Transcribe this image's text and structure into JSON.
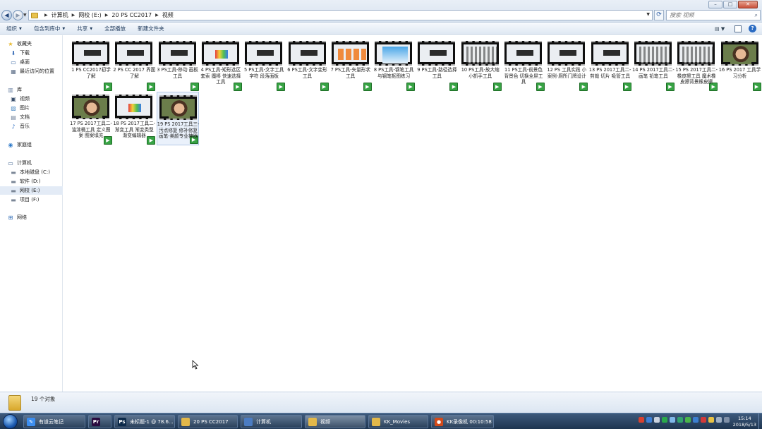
{
  "window": {
    "minimize": "–",
    "maximize": "□",
    "close": "✕"
  },
  "address": {
    "crumbs": [
      "计算机",
      "网校 (E:)",
      "20 PS CC2017",
      "视频"
    ],
    "search_placeholder": "搜索 视频"
  },
  "toolbar": {
    "organize": "组织",
    "include_in_library": "包含到库中",
    "share": "共享",
    "play_all": "全部播放",
    "new_folder": "新建文件夹"
  },
  "sidebar": {
    "items": [
      {
        "label": "收藏夹",
        "icon": "star-icon"
      },
      {
        "label": "下载",
        "icon": "download-icon"
      },
      {
        "label": "桌面",
        "icon": "desktop-icon"
      },
      {
        "label": "最近访问的位置",
        "icon": "recent-places-icon"
      },
      {
        "label": "库",
        "icon": "library-icon"
      },
      {
        "label": "视频",
        "icon": "video-library-icon"
      },
      {
        "label": "图片",
        "icon": "pictures-icon"
      },
      {
        "label": "文档",
        "icon": "documents-icon"
      },
      {
        "label": "音乐",
        "icon": "music-icon"
      },
      {
        "label": "家庭组",
        "icon": "homegroup-icon"
      },
      {
        "label": "计算机",
        "icon": "computer-icon"
      },
      {
        "label": "本地磁盘 (C:)",
        "icon": "drive-icon"
      },
      {
        "label": "软件 (D:)",
        "icon": "drive-icon"
      },
      {
        "label": "网校 (E:)",
        "icon": "drive-icon"
      },
      {
        "label": "项目 (F:)",
        "icon": "drive-icon"
      },
      {
        "label": "网络",
        "icon": "network-icon"
      }
    ]
  },
  "files": [
    {
      "name": "1 PS CC2017初学了解",
      "thumb": "white"
    },
    {
      "name": "2 PS CC 2017 界面了解",
      "thumb": "white"
    },
    {
      "name": "3 PS工具-移动 画板工具",
      "thumb": "white"
    },
    {
      "name": "4 PS工具-矩形选区 套索 魔棒 快速选择工具",
      "thumb": "color"
    },
    {
      "name": "5 PS工具-文字工具字符 段落面板",
      "thumb": "white"
    },
    {
      "name": "6 PS工具-文字变形工具",
      "thumb": "white"
    },
    {
      "name": "7 PS工具-矢量形状工具",
      "thumb": "blocks"
    },
    {
      "name": "8 PS工具-钢笔工具与钢笔抠图练习",
      "thumb": "sky"
    },
    {
      "name": "9 PS工具-路径选择工具",
      "thumb": "white"
    },
    {
      "name": "10 PS工具-放大缩小抓手工具",
      "thumb": "grid"
    },
    {
      "name": "11 PS工具-前景色背景色 切换全屏工具",
      "thumb": "white"
    },
    {
      "name": "12 PS 工具实践 小案例-厕所门牌设计",
      "thumb": "white"
    },
    {
      "name": "13 PS 2017工具二-剪裁 切片 吸管工具",
      "thumb": "white"
    },
    {
      "name": "14 PS 2017工具二-画笔 铅笔工具",
      "thumb": "grid"
    },
    {
      "name": "15 PS 2017工具二-橡皮擦工具 魔术橡皮擦背景橡皮擦",
      "thumb": "grid"
    },
    {
      "name": "16 PS 2017 工具学习分析",
      "thumb": "face"
    },
    {
      "name": "17 PS 2017工具二-油漆桶工具 定义图案 图案填充",
      "thumb": "face"
    },
    {
      "name": "18 PS 2017工具二-渐变工具 渐变类型 渐变编辑器",
      "thumb": "color"
    },
    {
      "name": "19 PS 2017工具三-污点修复 修补修复画笔-美颜专业神器",
      "thumb": "face"
    }
  ],
  "status": {
    "count": "19 个对象"
  },
  "taskbar": {
    "items": [
      {
        "label": "有道云笔记",
        "color": "#3c8ef0",
        "glyph": "✎"
      },
      {
        "label": "",
        "color": "#2a0b3f",
        "glyph": "Pr"
      },
      {
        "label": "未标题-1 @ 78.6...",
        "color": "#0c2a4a",
        "glyph": "Ps"
      },
      {
        "label": "20 PS CC2017",
        "color": "#e2b84a",
        "glyph": ""
      },
      {
        "label": "计算机",
        "color": "#4b7cc2",
        "glyph": ""
      },
      {
        "label": "视频",
        "color": "#e2b84a",
        "glyph": ""
      },
      {
        "label": "KK_Movies",
        "color": "#e2b84a",
        "glyph": ""
      },
      {
        "label": "KK录像机 00:10:58",
        "color": "#d24a1a",
        "glyph": "●"
      }
    ],
    "time": "15:14",
    "date": "2018/5/13"
  }
}
